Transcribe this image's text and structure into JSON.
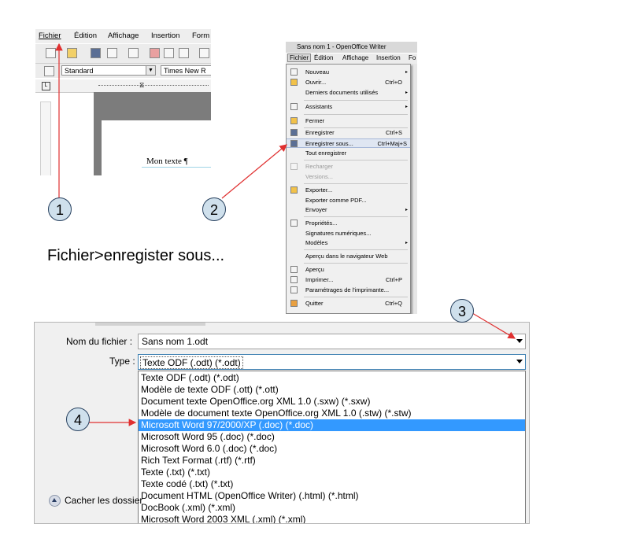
{
  "writer_crop": {
    "menu": [
      "Fichier",
      "Édition",
      "Affichage",
      "Insertion",
      "Form"
    ],
    "style_combo": "Standard",
    "font_combo": "Times New R",
    "doc_text": "Mon texte ¶"
  },
  "file_menu": {
    "window_title": "Sans nom 1 - OpenOffice Writer",
    "menubar": [
      "Fichier",
      "Édition",
      "Affichage",
      "Insertion",
      "Fo"
    ],
    "items": [
      {
        "label": "Nouveau",
        "shortcut": "",
        "submenu": "▸"
      },
      {
        "label": "Ouvrir...",
        "shortcut": "Ctrl+O",
        "submenu": ""
      },
      {
        "label": "Derniers documents utilisés",
        "shortcut": "",
        "submenu": "▸"
      },
      {
        "label": "Assistants",
        "shortcut": "",
        "submenu": "▸"
      },
      {
        "label": "Fermer",
        "shortcut": "",
        "submenu": ""
      },
      {
        "label": "Enregistrer",
        "shortcut": "Ctrl+S",
        "submenu": ""
      },
      {
        "label": "Enregistrer sous...",
        "shortcut": "Ctrl+Maj+S",
        "submenu": ""
      },
      {
        "label": "Tout enregistrer",
        "shortcut": "",
        "submenu": ""
      },
      {
        "label": "Recharger",
        "shortcut": "",
        "submenu": ""
      },
      {
        "label": "Versions...",
        "shortcut": "",
        "submenu": ""
      },
      {
        "label": "Exporter...",
        "shortcut": "",
        "submenu": ""
      },
      {
        "label": "Exporter comme PDF...",
        "shortcut": "",
        "submenu": ""
      },
      {
        "label": "Envoyer",
        "shortcut": "",
        "submenu": "▸"
      },
      {
        "label": "Propriétés...",
        "shortcut": "",
        "submenu": ""
      },
      {
        "label": "Signatures numériques...",
        "shortcut": "",
        "submenu": ""
      },
      {
        "label": "Modèles",
        "shortcut": "",
        "submenu": "▸"
      },
      {
        "label": "Aperçu dans le navigateur Web",
        "shortcut": "",
        "submenu": ""
      },
      {
        "label": "Aperçu",
        "shortcut": "",
        "submenu": ""
      },
      {
        "label": "Imprimer...",
        "shortcut": "Ctrl+P",
        "submenu": ""
      },
      {
        "label": "Paramétrages de l'imprimante...",
        "shortcut": "",
        "submenu": ""
      },
      {
        "label": "Quitter",
        "shortcut": "Ctrl+Q",
        "submenu": ""
      }
    ]
  },
  "caption": "Fichier>enregister sous...",
  "callouts": [
    "1",
    "2",
    "3",
    "4"
  ],
  "save_dialog": {
    "filename_label": "Nom du fichier :",
    "filename_value": "Sans nom 1.odt",
    "type_label": "Type :",
    "type_value": "Texte ODF (.odt) (*.odt)",
    "hide_folders": "Cacher les dossier",
    "options": [
      "Texte ODF (.odt) (*.odt)",
      "Modèle de texte ODF (.ott) (*.ott)",
      "Document texte OpenOffice.org XML 1.0 (.sxw) (*.sxw)",
      "Modèle de document texte OpenOffice.org XML 1.0  (.stw) (*.stw)",
      "Microsoft Word 97/2000/XP (.doc) (*.doc)",
      "Microsoft Word 95 (.doc) (*.doc)",
      "Microsoft Word 6.0 (.doc) (*.doc)",
      "Rich Text Format (.rtf) (*.rtf)",
      "Texte (.txt) (*.txt)",
      "Texte codé (.txt) (*.txt)",
      "Document HTML (OpenOffice Writer) (.html) (*.html)",
      "DocBook (.xml) (*.xml)",
      "Microsoft Word 2003 XML (.xml) (*.xml)"
    ],
    "selected_option": "Microsoft Word 97/2000/XP (.doc) (*.doc)"
  },
  "colors": {
    "selection": "#3399ff",
    "callout_fill": "#cfe0ec",
    "arrow": "#e03030"
  }
}
